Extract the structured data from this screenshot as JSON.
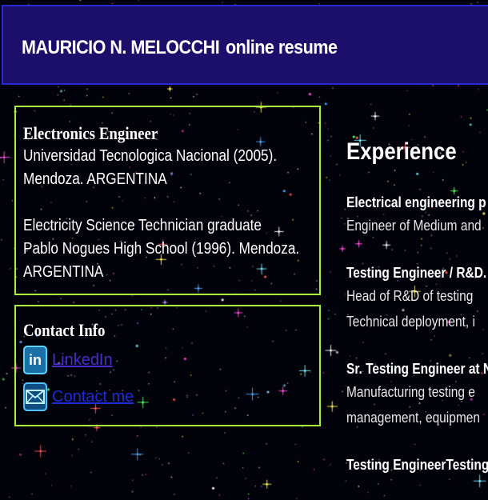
{
  "header": {
    "name": "MAURICIO N. MELOCCHI",
    "subtitle": "online resume"
  },
  "education": {
    "degree": "Electronics Engineer",
    "university": "Universidad Tecnologica Nacional (2005).",
    "university_location": "Mendoza. ARGENTINA",
    "technician": "Electricity Science Technician graduate",
    "school": "Pablo Nogues High School (1996). Mendoza.",
    "school_location": "ARGENTINA"
  },
  "contact": {
    "title": "Contact Info",
    "linkedin_icon": "linkedin-icon",
    "linkedin_label": "LinkedIn",
    "mail_icon": "envelope-icon",
    "mail_label": "Contact me"
  },
  "experience": {
    "heading": "Experience",
    "jobs": [
      {
        "title": "Electrical engineering p",
        "desc": [
          "Engineer of Medium and"
        ]
      },
      {
        "title": "Testing Engineer / R&D.",
        "desc": [
          "Head of R&D of testing",
          "Technical deployment, i"
        ]
      },
      {
        "title": "Sr. Testing Engineer at N",
        "desc": [
          "Manufacturing testing e",
          "management, equipmen"
        ]
      },
      {
        "title": "Testing EngineerTesting",
        "desc": []
      }
    ]
  },
  "colors": {
    "header_bg": "#1b0f6b",
    "box_border": "#a6f23c",
    "link": "#4b2bcf"
  }
}
